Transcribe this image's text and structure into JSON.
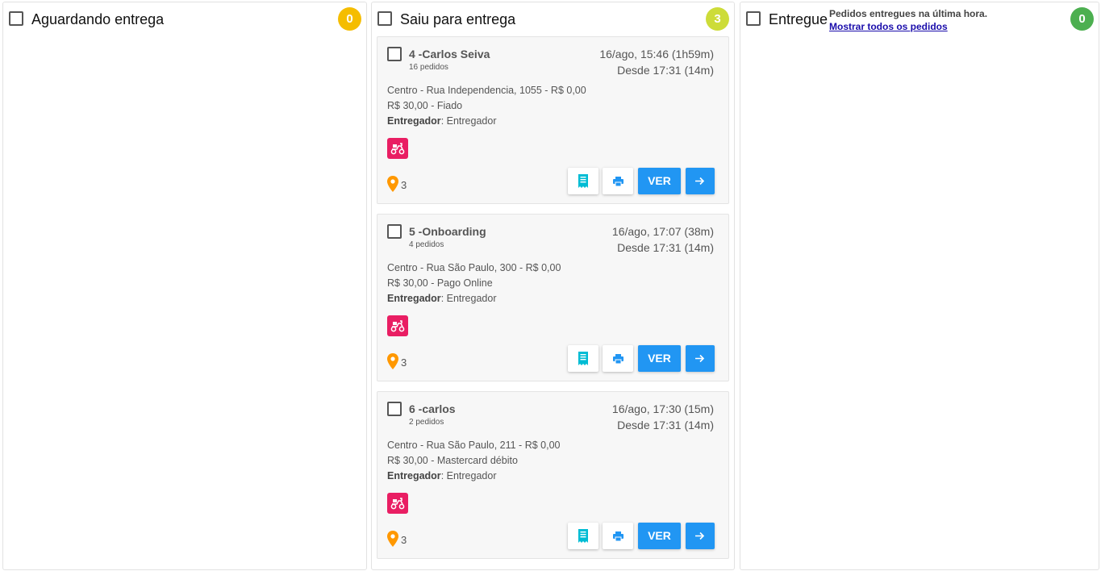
{
  "colors": {
    "badge_yellow": "#f5bd00",
    "badge_lime": "#cddc39",
    "badge_green": "#4caf50",
    "primary_blue": "#2196f3",
    "moto_pink": "#e91e63",
    "pin_orange": "#ff9800",
    "receipt_teal": "#00bcd4"
  },
  "columns": [
    {
      "title": "Aguardando entrega",
      "count": "0"
    },
    {
      "title": "Saiu para entrega",
      "count": "3"
    },
    {
      "title": "Entregue",
      "count": "0",
      "note": "Pedidos entregues na última hora.",
      "link": "Mostrar todos os pedidos"
    }
  ],
  "orders": [
    {
      "name": "4 -Carlos Seiva",
      "orders_count": "16 pedidos",
      "datetime": "16/ago, 15:46 (1h59m)",
      "since": "Desde 17:31 (14m)",
      "address": "Centro - Rua Independencia, 1055 - R$ 0,00",
      "payment": "R$ 30,00 - Fiado",
      "deliverer_label": "Entregador",
      "deliverer": ": Entregador",
      "stops": "3",
      "ver_label": "VER"
    },
    {
      "name": "5 -Onboarding",
      "orders_count": "4 pedidos",
      "datetime": "16/ago, 17:07 (38m)",
      "since": "Desde 17:31 (14m)",
      "address": "Centro - Rua São Paulo, 300 - R$ 0,00",
      "payment": "R$ 30,00 - Pago Online",
      "deliverer_label": "Entregador",
      "deliverer": ": Entregador",
      "stops": "3",
      "ver_label": "VER"
    },
    {
      "name": "6 -carlos",
      "orders_count": "2 pedidos",
      "datetime": "16/ago, 17:30 (15m)",
      "since": "Desde 17:31 (14m)",
      "address": "Centro - Rua São Paulo, 211 - R$ 0,00",
      "payment": "R$ 30,00 - Mastercard débito",
      "deliverer_label": "Entregador",
      "deliverer": ": Entregador",
      "stops": "3",
      "ver_label": "VER"
    }
  ],
  "icons": {
    "moto": "delivery-scooter-icon",
    "pin": "map-pin-icon",
    "receipt": "receipt-icon",
    "print": "printer-icon",
    "forward": "arrow-right-icon"
  }
}
